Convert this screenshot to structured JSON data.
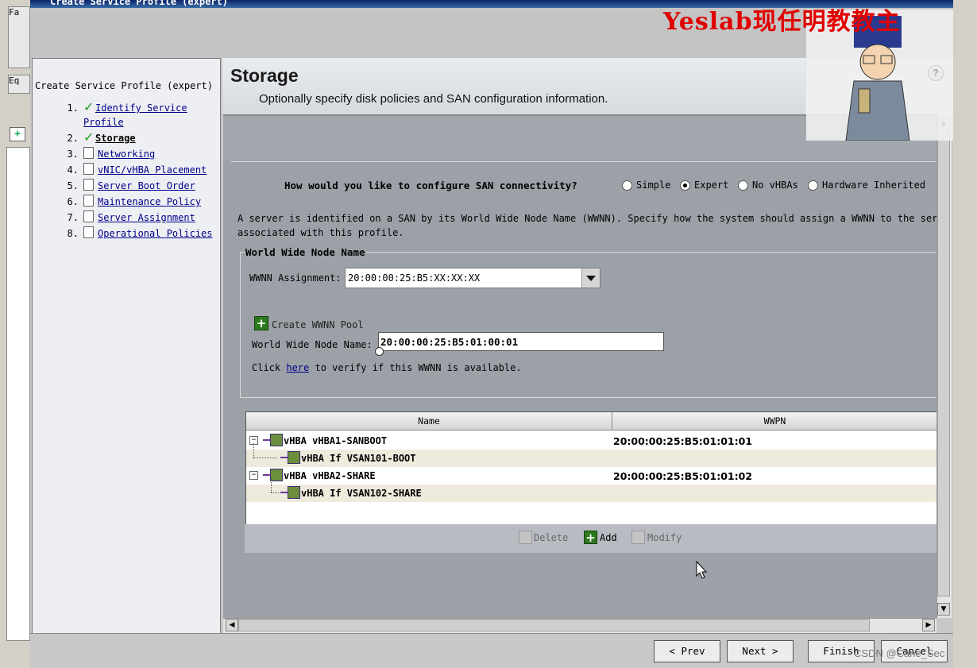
{
  "window": {
    "title": "Create Service Profile (expert)",
    "watermark": "Yeslab现任明教教主",
    "background_tab_labels": [
      "Fa",
      "Eq"
    ]
  },
  "nav": {
    "title": "Create Service Profile (expert)",
    "steps": [
      {
        "num": "1.",
        "label_line1": "Identify Service",
        "label_line2": "Profile",
        "status": "done"
      },
      {
        "num": "2.",
        "label": "Storage",
        "status": "current"
      },
      {
        "num": "3.",
        "label": "Networking",
        "status": "pending"
      },
      {
        "num": "4.",
        "label": "vNIC/vHBA Placement",
        "status": "pending"
      },
      {
        "num": "5.",
        "label": "Server Boot Order",
        "status": "pending"
      },
      {
        "num": "6.",
        "label": "Maintenance Policy",
        "status": "pending"
      },
      {
        "num": "7.",
        "label": "Server Assignment",
        "status": "pending"
      },
      {
        "num": "8.",
        "label": "Operational Policies",
        "status": "pending"
      }
    ]
  },
  "header": {
    "title": "Storage",
    "subtitle": "Optionally specify disk policies and SAN configuration information.",
    "help_icon": "?"
  },
  "san": {
    "question": "How would you like to configure SAN connectivity?",
    "options": [
      {
        "label": "Simple",
        "selected": false
      },
      {
        "label": "Expert",
        "selected": true
      },
      {
        "label": "No vHBAs",
        "selected": false
      },
      {
        "label": "Hardware Inherited",
        "selected": false
      }
    ],
    "description_line1": "A server is identified on a SAN by its World Wide Node Name (WWNN). Specify how the system should assign a WWNN to the ser",
    "description_line2": "associated with this profile."
  },
  "wwnn": {
    "legend": "World Wide Node Name",
    "assignment_label": "WWNN Assignment:",
    "assignment_value": "20:00:00:25:B5:XX:XX:XX",
    "create_pool_label": "Create WWNN Pool",
    "node_name_label": "World Wide Node Name:",
    "node_name_value": "20:00:00:25:B5:01:00:01",
    "verify_prefix": "Click",
    "verify_link": "here",
    "verify_suffix": "to verify if this WWNN is available."
  },
  "vhba_table": {
    "columns": [
      "Name",
      "WWPN"
    ],
    "rows": [
      {
        "name": "vHBA vHBA1-SANBOOT",
        "wwpn": "20:00:00:25:B5:01:01:01",
        "level": 0
      },
      {
        "name": "vHBA If VSAN101-BOOT",
        "wwpn": "",
        "level": 1
      },
      {
        "name": "vHBA vHBA2-SHARE",
        "wwpn": "20:00:00:25:B5:01:01:02",
        "level": 0
      },
      {
        "name": "vHBA If VSAN102-SHARE",
        "wwpn": "",
        "level": 1
      }
    ],
    "actions": {
      "delete": "Delete",
      "add": "Add",
      "modify": "Modify"
    }
  },
  "footer": {
    "prev": "< Prev",
    "next": "Next >",
    "finish": "Finish",
    "cancel": "Cancel",
    "watermark": "CSDN @Cane_Sec"
  }
}
